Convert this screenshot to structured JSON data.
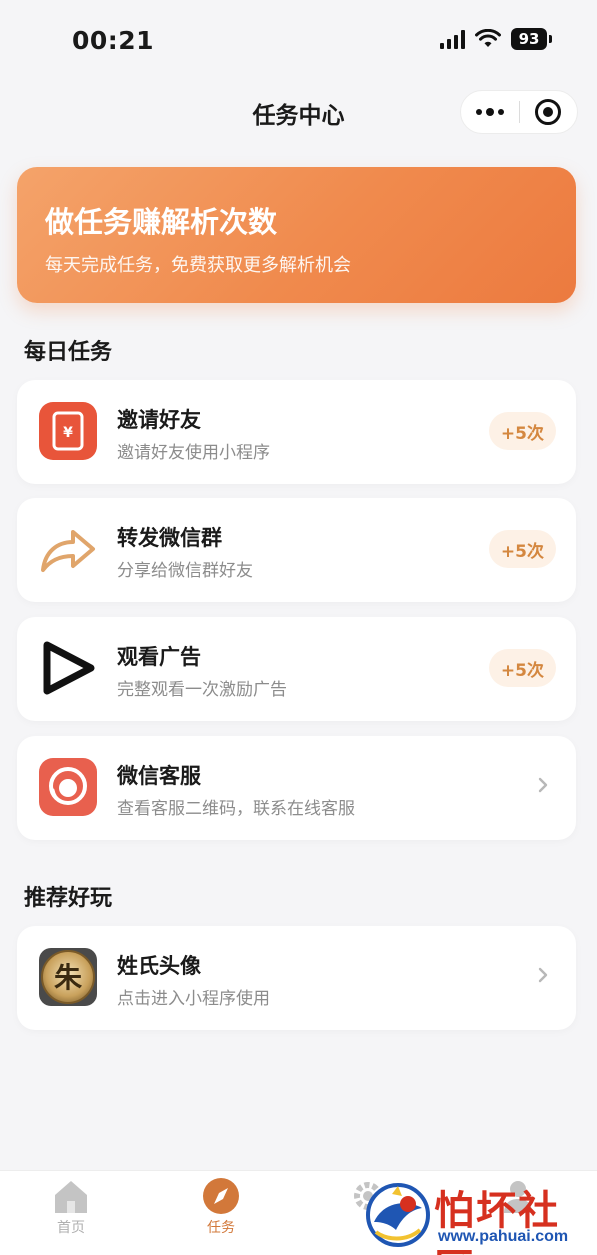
{
  "status_bar": {
    "time": "00:21",
    "battery": "93"
  },
  "nav": {
    "title": "任务中心"
  },
  "banner": {
    "title": "做任务赚解析次数",
    "subtitle": "每天完成任务，免费获取更多解析机会"
  },
  "sections": {
    "daily": "每日任务",
    "recommend": "推荐好玩"
  },
  "tasks": [
    {
      "title": "邀请好友",
      "desc": "邀请好友使用小程序",
      "reward": "+5次",
      "icon": "red-envelope-icon"
    },
    {
      "title": "转发微信群",
      "desc": "分享给微信群好友",
      "reward": "+5次",
      "icon": "share-arrow-icon"
    },
    {
      "title": "观看广告",
      "desc": "完整观看一次激励广告",
      "reward": "+5次",
      "icon": "play-icon"
    },
    {
      "title": "微信客服",
      "desc": "查看客服二维码，联系在线客服",
      "icon": "customer-service-icon"
    }
  ],
  "recommend": [
    {
      "title": "姓氏头像",
      "desc": "点击进入小程序使用",
      "icon": "surname-avatar-icon",
      "icon_text": "朱"
    }
  ],
  "tabbar": {
    "items": [
      {
        "label": "首页",
        "icon": "home-icon"
      },
      {
        "label": "任务",
        "icon": "compass-icon",
        "active": true
      },
      {
        "label": "",
        "icon": "gear-icon"
      },
      {
        "label": "",
        "icon": "user-icon"
      }
    ]
  },
  "watermark": {
    "text": "怕坏社区",
    "url": "www.pahuai.com"
  },
  "colors": {
    "accent": "#f08a4d",
    "reward_bg": "#fdf1e6",
    "reward_text": "#d4873f",
    "watermark_red": "#d6301f",
    "watermark_blue": "#1f56b3"
  }
}
